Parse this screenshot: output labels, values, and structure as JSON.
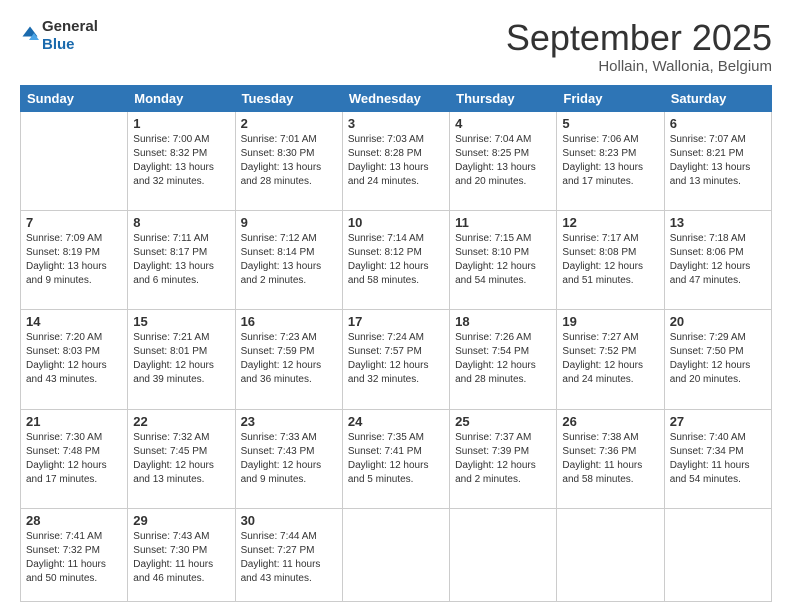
{
  "logo": {
    "general": "General",
    "blue": "Blue"
  },
  "header": {
    "month": "September 2025",
    "location": "Hollain, Wallonia, Belgium"
  },
  "weekdays": [
    "Sunday",
    "Monday",
    "Tuesday",
    "Wednesday",
    "Thursday",
    "Friday",
    "Saturday"
  ],
  "weeks": [
    [
      {
        "day": "",
        "info": ""
      },
      {
        "day": "1",
        "info": "Sunrise: 7:00 AM\nSunset: 8:32 PM\nDaylight: 13 hours\nand 32 minutes."
      },
      {
        "day": "2",
        "info": "Sunrise: 7:01 AM\nSunset: 8:30 PM\nDaylight: 13 hours\nand 28 minutes."
      },
      {
        "day": "3",
        "info": "Sunrise: 7:03 AM\nSunset: 8:28 PM\nDaylight: 13 hours\nand 24 minutes."
      },
      {
        "day": "4",
        "info": "Sunrise: 7:04 AM\nSunset: 8:25 PM\nDaylight: 13 hours\nand 20 minutes."
      },
      {
        "day": "5",
        "info": "Sunrise: 7:06 AM\nSunset: 8:23 PM\nDaylight: 13 hours\nand 17 minutes."
      },
      {
        "day": "6",
        "info": "Sunrise: 7:07 AM\nSunset: 8:21 PM\nDaylight: 13 hours\nand 13 minutes."
      }
    ],
    [
      {
        "day": "7",
        "info": "Sunrise: 7:09 AM\nSunset: 8:19 PM\nDaylight: 13 hours\nand 9 minutes."
      },
      {
        "day": "8",
        "info": "Sunrise: 7:11 AM\nSunset: 8:17 PM\nDaylight: 13 hours\nand 6 minutes."
      },
      {
        "day": "9",
        "info": "Sunrise: 7:12 AM\nSunset: 8:14 PM\nDaylight: 13 hours\nand 2 minutes."
      },
      {
        "day": "10",
        "info": "Sunrise: 7:14 AM\nSunset: 8:12 PM\nDaylight: 12 hours\nand 58 minutes."
      },
      {
        "day": "11",
        "info": "Sunrise: 7:15 AM\nSunset: 8:10 PM\nDaylight: 12 hours\nand 54 minutes."
      },
      {
        "day": "12",
        "info": "Sunrise: 7:17 AM\nSunset: 8:08 PM\nDaylight: 12 hours\nand 51 minutes."
      },
      {
        "day": "13",
        "info": "Sunrise: 7:18 AM\nSunset: 8:06 PM\nDaylight: 12 hours\nand 47 minutes."
      }
    ],
    [
      {
        "day": "14",
        "info": "Sunrise: 7:20 AM\nSunset: 8:03 PM\nDaylight: 12 hours\nand 43 minutes."
      },
      {
        "day": "15",
        "info": "Sunrise: 7:21 AM\nSunset: 8:01 PM\nDaylight: 12 hours\nand 39 minutes."
      },
      {
        "day": "16",
        "info": "Sunrise: 7:23 AM\nSunset: 7:59 PM\nDaylight: 12 hours\nand 36 minutes."
      },
      {
        "day": "17",
        "info": "Sunrise: 7:24 AM\nSunset: 7:57 PM\nDaylight: 12 hours\nand 32 minutes."
      },
      {
        "day": "18",
        "info": "Sunrise: 7:26 AM\nSunset: 7:54 PM\nDaylight: 12 hours\nand 28 minutes."
      },
      {
        "day": "19",
        "info": "Sunrise: 7:27 AM\nSunset: 7:52 PM\nDaylight: 12 hours\nand 24 minutes."
      },
      {
        "day": "20",
        "info": "Sunrise: 7:29 AM\nSunset: 7:50 PM\nDaylight: 12 hours\nand 20 minutes."
      }
    ],
    [
      {
        "day": "21",
        "info": "Sunrise: 7:30 AM\nSunset: 7:48 PM\nDaylight: 12 hours\nand 17 minutes."
      },
      {
        "day": "22",
        "info": "Sunrise: 7:32 AM\nSunset: 7:45 PM\nDaylight: 12 hours\nand 13 minutes."
      },
      {
        "day": "23",
        "info": "Sunrise: 7:33 AM\nSunset: 7:43 PM\nDaylight: 12 hours\nand 9 minutes."
      },
      {
        "day": "24",
        "info": "Sunrise: 7:35 AM\nSunset: 7:41 PM\nDaylight: 12 hours\nand 5 minutes."
      },
      {
        "day": "25",
        "info": "Sunrise: 7:37 AM\nSunset: 7:39 PM\nDaylight: 12 hours\nand 2 minutes."
      },
      {
        "day": "26",
        "info": "Sunrise: 7:38 AM\nSunset: 7:36 PM\nDaylight: 11 hours\nand 58 minutes."
      },
      {
        "day": "27",
        "info": "Sunrise: 7:40 AM\nSunset: 7:34 PM\nDaylight: 11 hours\nand 54 minutes."
      }
    ],
    [
      {
        "day": "28",
        "info": "Sunrise: 7:41 AM\nSunset: 7:32 PM\nDaylight: 11 hours\nand 50 minutes."
      },
      {
        "day": "29",
        "info": "Sunrise: 7:43 AM\nSunset: 7:30 PM\nDaylight: 11 hours\nand 46 minutes."
      },
      {
        "day": "30",
        "info": "Sunrise: 7:44 AM\nSunset: 7:27 PM\nDaylight: 11 hours\nand 43 minutes."
      },
      {
        "day": "",
        "info": ""
      },
      {
        "day": "",
        "info": ""
      },
      {
        "day": "",
        "info": ""
      },
      {
        "day": "",
        "info": ""
      }
    ]
  ]
}
